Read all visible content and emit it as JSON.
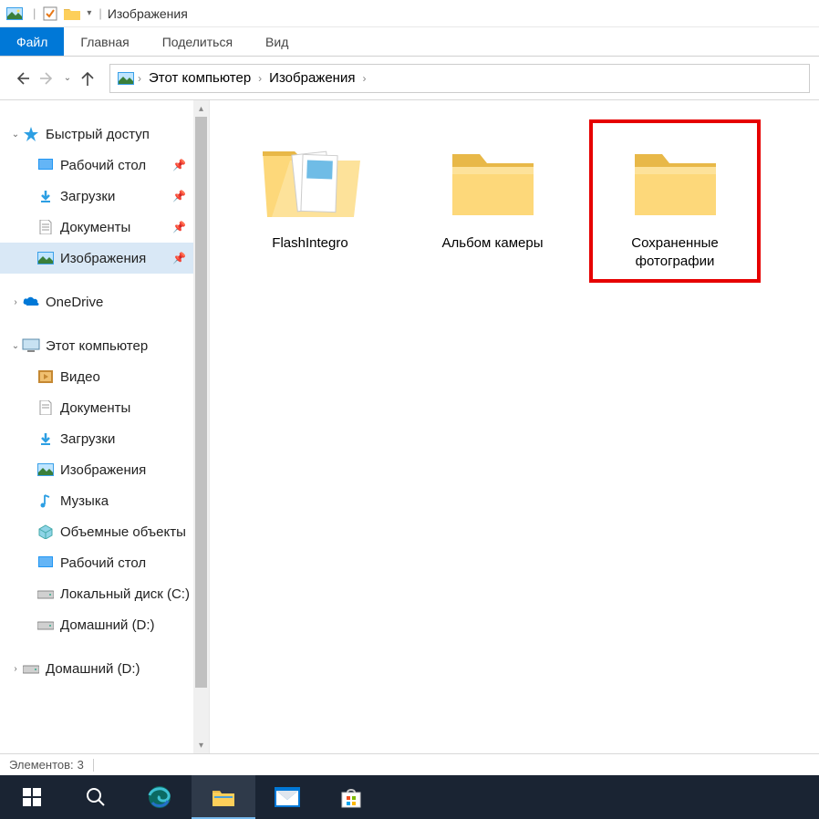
{
  "title_bar": {
    "title": "Изображения"
  },
  "ribbon": {
    "file": "Файл",
    "tabs": [
      "Главная",
      "Поделиться",
      "Вид"
    ]
  },
  "breadcrumbs": [
    "Этот компьютер",
    "Изображения"
  ],
  "nav_tree": {
    "quick_access": {
      "label": "Быстрый доступ",
      "expanded": true
    },
    "quick_items": [
      {
        "label": "Рабочий стол",
        "icon": "desktop",
        "pinned": true
      },
      {
        "label": "Загрузки",
        "icon": "downloads",
        "pinned": true
      },
      {
        "label": "Документы",
        "icon": "documents",
        "pinned": true
      },
      {
        "label": "Изображения",
        "icon": "pictures",
        "pinned": true,
        "selected": true
      }
    ],
    "onedrive": {
      "label": "OneDrive"
    },
    "this_pc": {
      "label": "Этот компьютер",
      "expanded": true
    },
    "pc_items": [
      {
        "label": "Видео",
        "icon": "videos"
      },
      {
        "label": "Документы",
        "icon": "documents"
      },
      {
        "label": "Загрузки",
        "icon": "downloads"
      },
      {
        "label": "Изображения",
        "icon": "pictures"
      },
      {
        "label": "Музыка",
        "icon": "music"
      },
      {
        "label": "Объемные объекты",
        "icon": "3d"
      },
      {
        "label": "Рабочий стол",
        "icon": "desktop"
      },
      {
        "label": "Локальный диск (C:)",
        "icon": "drive"
      },
      {
        "label": "Домашний (D:)",
        "icon": "drive"
      }
    ],
    "extra": [
      {
        "label": "Домашний (D:)",
        "icon": "drive"
      }
    ]
  },
  "folders": [
    {
      "label": "FlashIntegro",
      "type": "folder-open",
      "highlighted": false
    },
    {
      "label": "Альбом камеры",
      "type": "folder",
      "highlighted": false
    },
    {
      "label": "Сохраненные фотографии",
      "type": "folder",
      "highlighted": true
    }
  ],
  "status": {
    "items_label": "Элементов:",
    "items_count": "3"
  },
  "taskbar": {
    "items": [
      "start",
      "search",
      "edge",
      "explorer",
      "mail",
      "store"
    ]
  }
}
